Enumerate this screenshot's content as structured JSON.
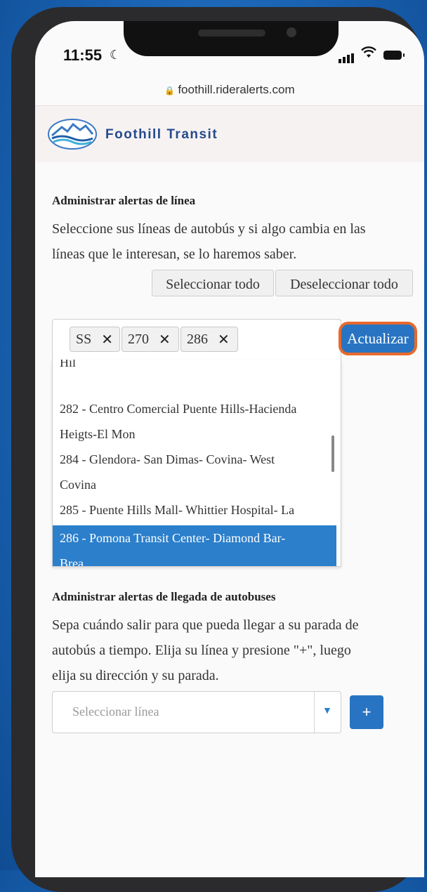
{
  "status_bar": {
    "time": "11:55"
  },
  "browser": {
    "url": "foothill.rideralerts.com"
  },
  "header": {
    "brand": "Foothill Transit"
  },
  "line_alerts": {
    "title": "Administrar alertas de línea",
    "description_line1": "Seleccione sus líneas de autobús y si algo cambia en las",
    "description_line2": "líneas que le interesan, se lo haremos saber.",
    "select_all": "Seleccionar todo",
    "deselect_all": "Deseleccionar todo",
    "tags": [
      "SS",
      "270",
      "286"
    ],
    "remove_glyph": "✕",
    "update_button": "Actualizar",
    "options": [
      "Hil",
      "282 - Centro Comercial Puente Hills-Hacienda",
      "Heigts-El Mon",
      "284 - Glendora- San Dimas- Covina- West",
      "Covina",
      "285 - Puente Hills Mall- Whittier Hospital- La",
      "286 - Pomona Transit Center- Diamond Bar-",
      "Brea"
    ]
  },
  "arrival_alerts": {
    "title": "Administrar alertas de llegada de autobuses",
    "line1": "Sepa cuándo salir para que pueda llegar a su parada de",
    "line2": "autobús a tiempo. Elija su línea y presione \"+\", luego",
    "line3": "elija su dirección y su parada.",
    "select_placeholder": "Seleccionar línea",
    "add_label": "+"
  },
  "colors": {
    "accent": "#2874c2",
    "highlight_ring": "#e8692c",
    "selected_option": "#2b7fcb"
  }
}
